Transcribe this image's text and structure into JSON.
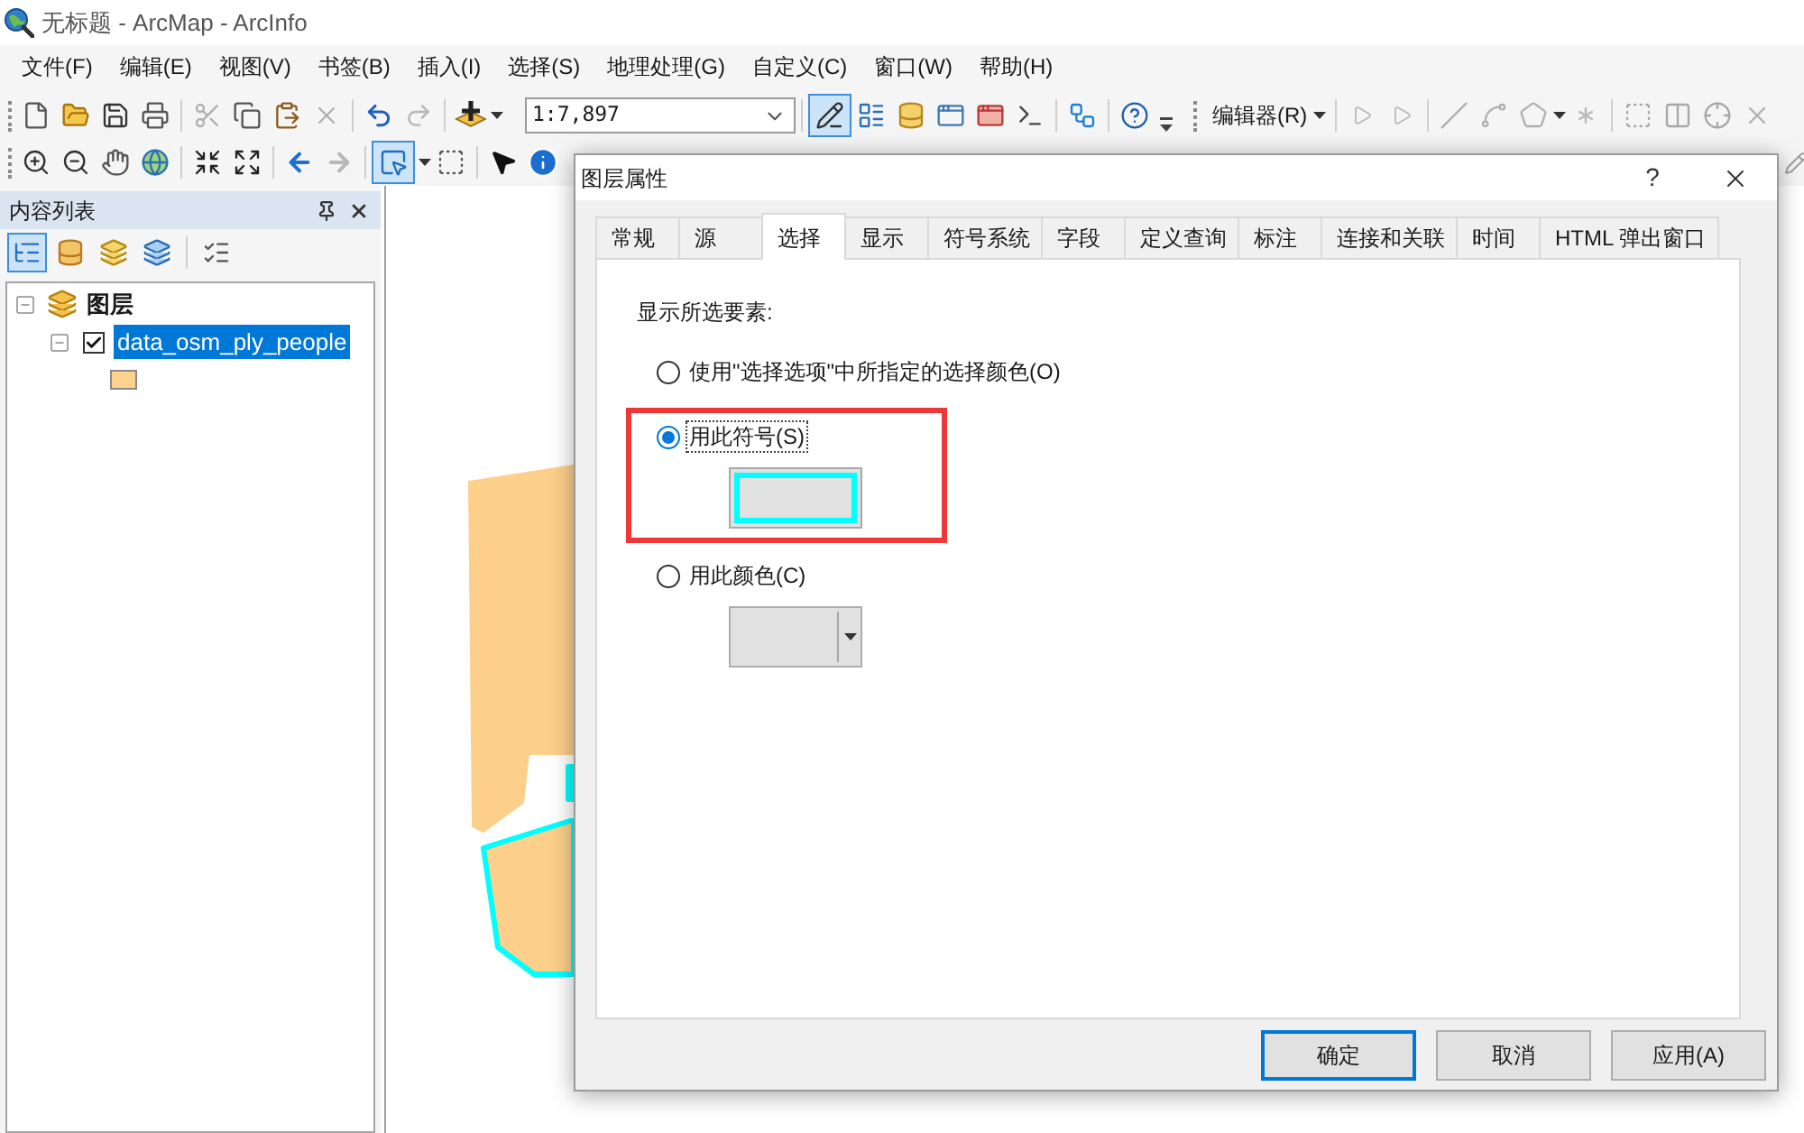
{
  "window": {
    "title": "无标题 - ArcMap - ArcInfo"
  },
  "menu_bar": [
    "文件(F)",
    "编辑(E)",
    "视图(V)",
    "书签(B)",
    "插入(I)",
    "选择(S)",
    "地理处理(G)",
    "自定义(C)",
    "窗口(W)",
    "帮助(H)"
  ],
  "toolbars": {
    "scale": "1:7,897",
    "editor_toolbar_button": {
      "selected": true
    },
    "editor_menu": "编辑器(R)",
    "select_tool": {
      "selected": true
    }
  },
  "table_of_contents": {
    "title": "内容列表",
    "view_buttons": [
      {
        "kind": "drawing_order",
        "selected": true
      },
      {
        "kind": "source",
        "selected": false
      },
      {
        "kind": "visibility",
        "selected": false
      },
      {
        "kind": "selection",
        "selected": false
      },
      {
        "kind": "options",
        "selected": false
      }
    ],
    "tree": [
      {
        "label": "图层",
        "expanded": true,
        "selected": false,
        "children": [
          {
            "label": "data_osm_ply_people",
            "checked": true,
            "selected": true,
            "expanded": true
          }
        ]
      }
    ]
  },
  "map": {
    "features": [
      {
        "selected": false
      },
      {
        "selected": true
      },
      {
        "selected": true
      }
    ]
  },
  "dialog": {
    "title": "图层属性",
    "help": "?",
    "tabs": [
      {
        "label": "常规",
        "selected": false
      },
      {
        "label": "源",
        "selected": false
      },
      {
        "label": "选择",
        "selected": true
      },
      {
        "label": "显示",
        "selected": false
      },
      {
        "label": "符号系统",
        "selected": false
      },
      {
        "label": "字段",
        "selected": false
      },
      {
        "label": "定义查询",
        "selected": false
      },
      {
        "label": "标注",
        "selected": false
      },
      {
        "label": "连接和关联",
        "selected": false
      },
      {
        "label": "时间",
        "selected": false
      },
      {
        "label": "HTML 弹出窗口",
        "selected": false
      }
    ],
    "section_label": "显示所选要素:",
    "options": [
      {
        "kind": "default_color",
        "label": "使用\"选择选项\"中所指定的选择颜色(O)",
        "selected": false,
        "highlighted": false
      },
      {
        "kind": "symbol",
        "label": "用此符号(S)",
        "selected": true,
        "highlighted": true
      },
      {
        "kind": "color",
        "label": "用此颜色(C)",
        "selected": false,
        "highlighted": false
      }
    ],
    "buttons": [
      {
        "label": "确定",
        "default": true
      },
      {
        "label": "取消",
        "default": false
      },
      {
        "label": "应用(A)",
        "default": false
      }
    ]
  }
}
